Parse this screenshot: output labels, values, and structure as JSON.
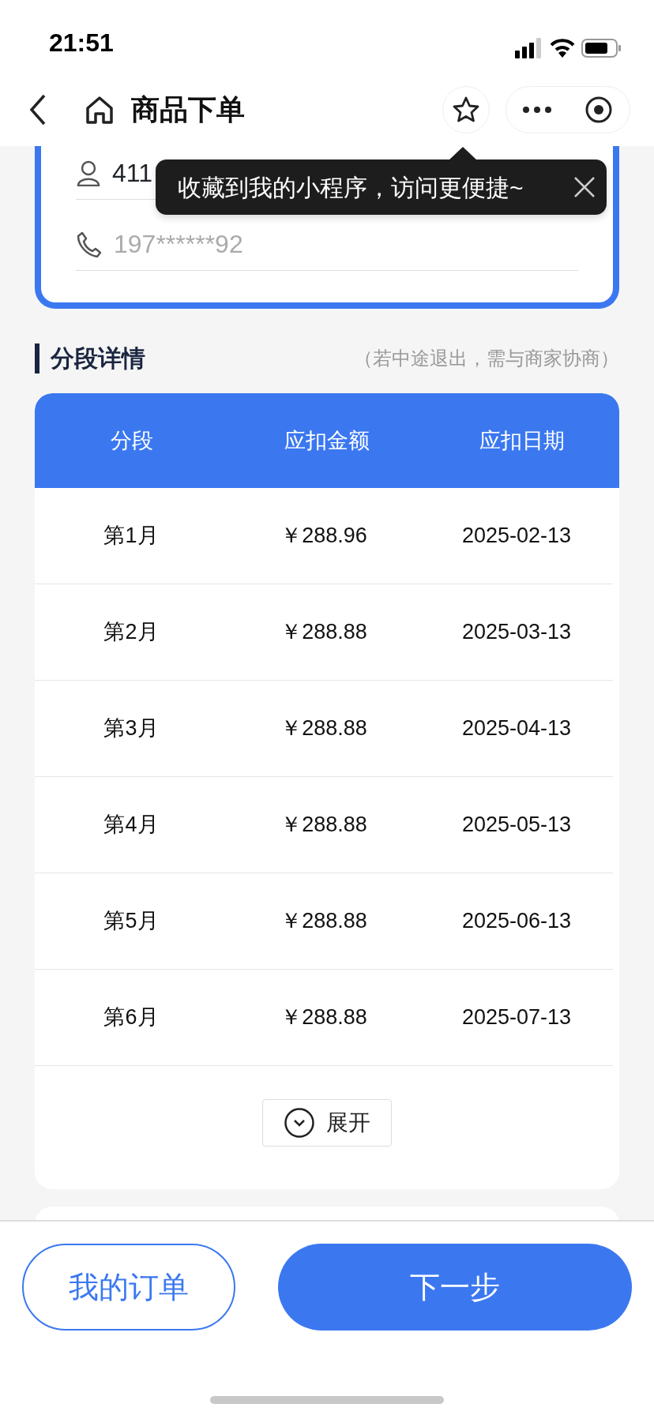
{
  "status_bar": {
    "time": "21:51"
  },
  "nav": {
    "title": "商品下单"
  },
  "tooltip": {
    "text": "收藏到我的小程序，访问更便捷~"
  },
  "contact": {
    "id_number": "411",
    "phone_placeholder": "197******92"
  },
  "section": {
    "title": "分段详情",
    "note": "（若中途退出，需与商家协商）"
  },
  "table": {
    "columns": [
      "分段",
      "应扣金额",
      "应扣日期"
    ],
    "rows": [
      {
        "period": "第1月",
        "amount": "￥288.96",
        "date": "2025-02-13"
      },
      {
        "period": "第2月",
        "amount": "￥288.88",
        "date": "2025-03-13"
      },
      {
        "period": "第3月",
        "amount": "￥288.88",
        "date": "2025-04-13"
      },
      {
        "period": "第4月",
        "amount": "￥288.88",
        "date": "2025-05-13"
      },
      {
        "period": "第5月",
        "amount": "￥288.88",
        "date": "2025-06-13"
      },
      {
        "period": "第6月",
        "amount": "￥288.88",
        "date": "2025-07-13"
      }
    ]
  },
  "expand_button": {
    "label": "展开"
  },
  "footer": {
    "secondary": "我的订单",
    "primary": "下一步"
  }
}
